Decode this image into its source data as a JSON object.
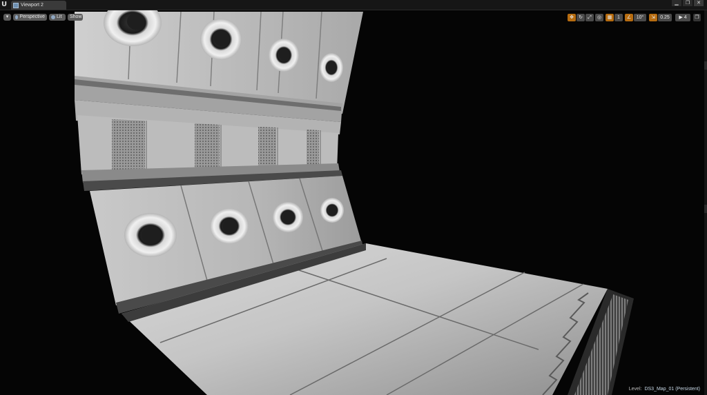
{
  "window": {
    "app_logo": "U",
    "tab_icon": "viewport-icon",
    "tab_label": "Viewport 2",
    "controls": {
      "minimize": "▁",
      "maximize": "❐",
      "close": "✕"
    }
  },
  "viewport_toolbar": {
    "menu_arrow": "▾",
    "perspective_label": "Perspective",
    "lit_label": "Lit",
    "show_label": "Show"
  },
  "right_toolbar": {
    "grid_snap_value": "1",
    "rotation_snap_value": "10°",
    "scale_snap_value": "0.25",
    "camera_speed_value": "4"
  },
  "status": {
    "level_key": "Level:",
    "level_name": "DS3_Map_01 (Persistent)"
  },
  "colors": {
    "viewport_bg": "#050505",
    "accent_orange": "#b66c10",
    "panel_light": "#d4d4d4",
    "panel_dark": "#7a7a7a"
  }
}
